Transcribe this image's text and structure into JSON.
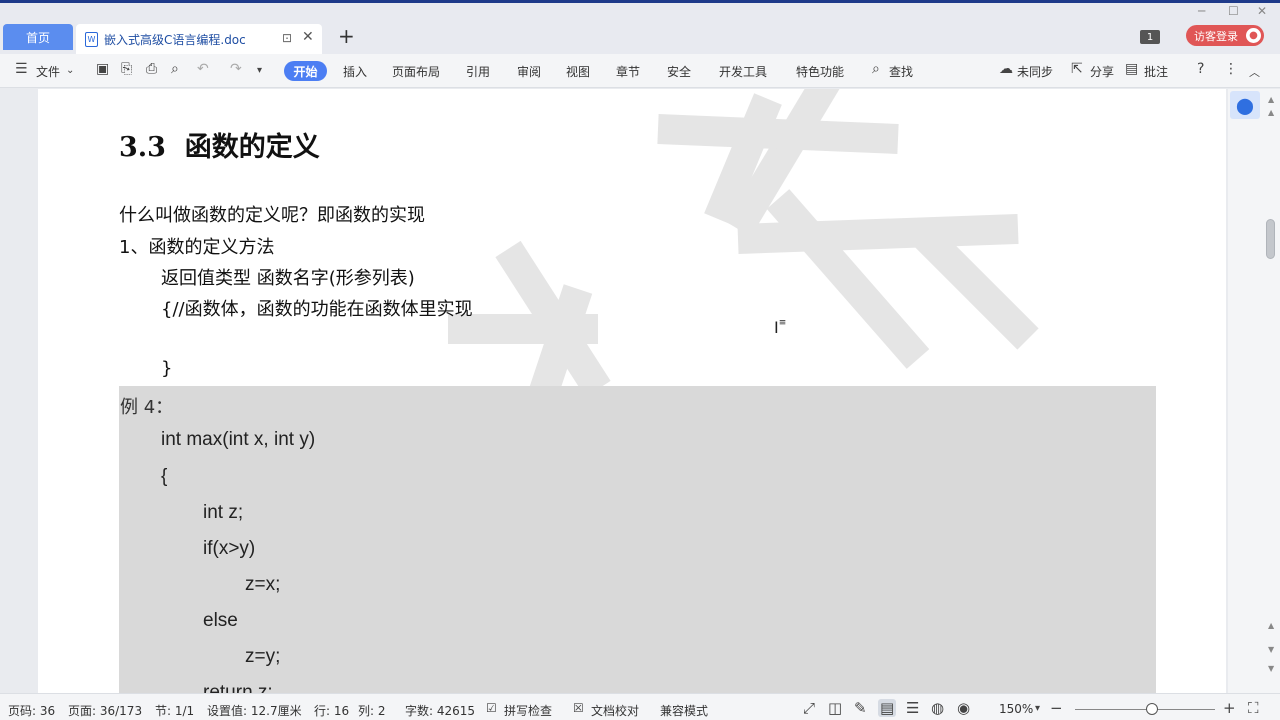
{
  "tabs": {
    "home": "首页",
    "document": "嵌入式高级C语言编程.doc",
    "login": "访客登录",
    "page_count_badge": "1"
  },
  "ribbon": {
    "file_menu": "文件",
    "tabs": [
      "开始",
      "插入",
      "页面布局",
      "引用",
      "审阅",
      "视图",
      "章节",
      "安全",
      "开发工具",
      "特色功能"
    ],
    "search": "查找",
    "sync": "未同步",
    "share": "分享",
    "comment": "批注"
  },
  "document": {
    "heading_number": "3.3",
    "heading_text": "函数的定义",
    "lines": [
      "什么叫做函数的定义呢？即函数的实现",
      "1、函数的定义方法",
      "返回值类型    函数名字(形参列表)",
      "{//函数体，函数的功能在函数体里实现",
      "}"
    ],
    "example_label": "例 4：",
    "code_lines": [
      "int max(int x, int y)",
      "{",
      "int z;",
      "if(x>y)",
      "z=x;",
      "else",
      "z=y;",
      "return z;"
    ]
  },
  "status": {
    "page_code": "页码: 36",
    "page": "页面: 36/173",
    "section": "节: 1/1",
    "setting": "设置值: 12.7厘米",
    "row": "行: 16",
    "col": "列: 2",
    "word_count": "字数: 42615",
    "spell_check": "拼写检查",
    "doc_proof": "文档校对",
    "compat_mode": "兼容模式",
    "zoom": "150%"
  },
  "colors": {
    "accent": "#4c7ef3",
    "login": "#e05656",
    "code_bg": "#d9d9d9"
  }
}
